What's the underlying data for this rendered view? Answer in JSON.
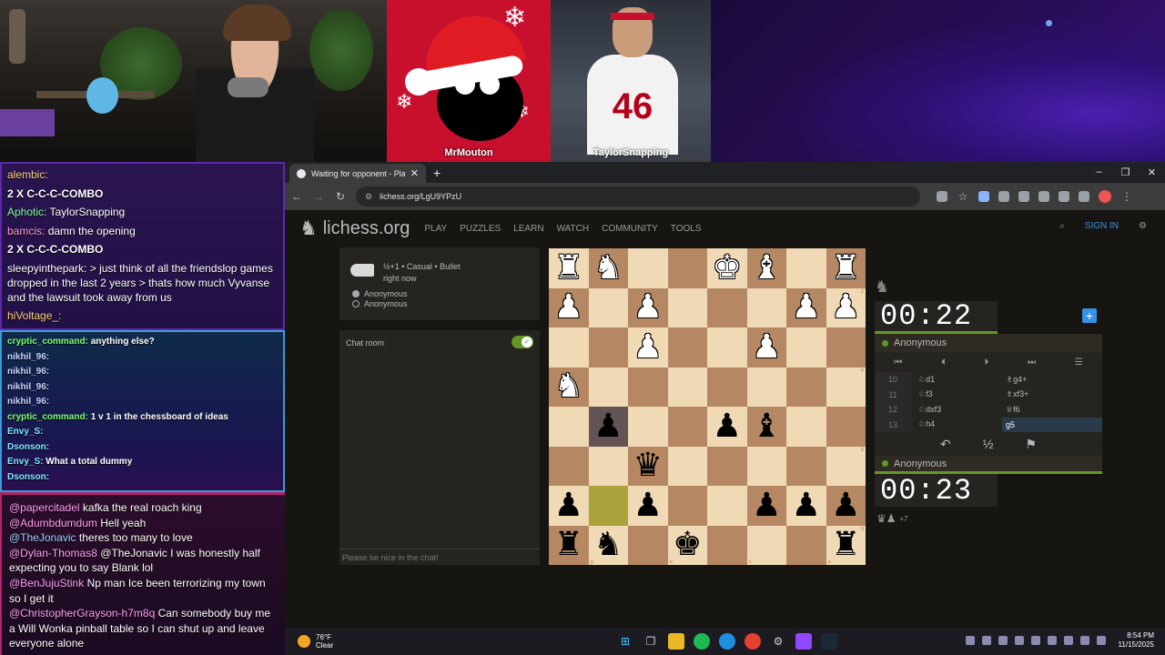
{
  "stream": {
    "cam_tiles": [
      {
        "name": "MrMouton"
      },
      {
        "name": "TaylorSnapping",
        "jersey_number": "46"
      }
    ]
  },
  "chat_panel_1": [
    {
      "user": "alembic:",
      "text": "",
      "style": "plain"
    },
    {
      "user": "",
      "text": "2 X C-C-C-COMBO",
      "style": "combo"
    },
    {
      "user": "Aphotic:",
      "text": "TaylorSnapping",
      "style": "green"
    },
    {
      "user": "bamcis:",
      "text": "damn the opening",
      "style": "pink"
    },
    {
      "user": "",
      "text": "2 X C-C-C-COMBO",
      "style": "combo"
    },
    {
      "user": "",
      "text": "sleepyinthepark: > just think of all the friendslop games dropped in the last 2 years > thats how much Vyvanse and the lawsuit took away from us",
      "style": "plain"
    },
    {
      "user": "hiVoltage_:",
      "text": "",
      "style": "plain"
    }
  ],
  "chat_panel_2": [
    {
      "user": "cryptic_command:",
      "text": "anything else?",
      "color": "green"
    },
    {
      "user": "nikhil_96:",
      "text": "",
      "color": ""
    },
    {
      "user": "nikhil_96:",
      "text": "",
      "color": ""
    },
    {
      "user": "nikhil_96:",
      "text": "",
      "color": ""
    },
    {
      "user": "nikhil_96:",
      "text": "",
      "color": ""
    },
    {
      "user": "cryptic_command:",
      "text": "1 v 1 in the chessboard of ideas",
      "color": "green"
    },
    {
      "user": "Envy_S:",
      "text": "",
      "color": "cyan"
    },
    {
      "user": "Dsonson:",
      "text": "",
      "color": "cyan"
    },
    {
      "user": "Envy_S:",
      "text": "What a total dummy",
      "color": "cyan"
    },
    {
      "user": "Dsonson:",
      "text": "",
      "color": "cyan"
    }
  ],
  "chat_panel_3": [
    {
      "user": "@papercitadel",
      "text": "kafka the real roach king",
      "color": ""
    },
    {
      "user": "@Adumbdumdum",
      "text": "Hell yeah",
      "color": ""
    },
    {
      "user": "@TheJonavic",
      "text": "theres too many to love",
      "color": "blue"
    },
    {
      "user": "@Dylan-Thomas8",
      "text": "@TheJonavic I was honestly half expecting you to say Blank lol",
      "color": ""
    },
    {
      "user": "@BenJujuStink",
      "text": "Np man Ice been terrorizing my town so I get it",
      "color": ""
    },
    {
      "user": "@ChristopherGrayson-h7m8q",
      "text": "Can somebody buy me a Will Wonka pinball table so I can shut up and leave everyone alone",
      "color": ""
    }
  ],
  "browser": {
    "tab_title": "Waiting for opponent - Play An",
    "url": "lichess.org/LgU9YPzU",
    "win_controls": [
      "–",
      "❐",
      "✕"
    ]
  },
  "lichess": {
    "logo_text": "lichess.org",
    "nav": [
      "PLAY",
      "PUZZLES",
      "LEARN",
      "WATCH",
      "COMMUNITY",
      "TOOLS"
    ],
    "sign_in": "SIGN IN",
    "game_mode": "½+1 • Casual • Bullet",
    "game_time": "right now",
    "players": [
      "Anonymous",
      "Anonymous"
    ],
    "chat_label": "Chat room",
    "chat_placeholder": "Please be nice in the chat!",
    "top_clock": "00:22",
    "bottom_clock": "00:23",
    "top_player": "Anonymous",
    "bottom_player": "Anonymous",
    "draw_symbol": "½",
    "material_diff": "+7",
    "moves": [
      {
        "n": "10",
        "w": "♘d1",
        "b": "♗g4+"
      },
      {
        "n": "11",
        "w": "♘f3",
        "b": "♗xf3+"
      },
      {
        "n": "12",
        "w": "♘dxf3",
        "b": "♕f6"
      },
      {
        "n": "13",
        "w": "♘h4",
        "b": "g5"
      }
    ]
  },
  "board": {
    "rows": [
      [
        "wr",
        "wn",
        "",
        "",
        "wk",
        "wb",
        "",
        "wr"
      ],
      [
        "wp",
        "",
        "wp",
        "",
        "",
        "",
        "wp",
        "wp"
      ],
      [
        "",
        "",
        "wp",
        "",
        "",
        "wp",
        "",
        ""
      ],
      [
        "wn",
        "",
        "",
        "",
        "",
        "",
        "",
        ""
      ],
      [
        "",
        "bp",
        "",
        "",
        "bp",
        "bb",
        "",
        ""
      ],
      [
        "",
        "",
        "bq",
        "",
        "",
        "",
        "",
        ""
      ],
      [
        "bp",
        "",
        "bp",
        "",
        "",
        "bp",
        "bp",
        "bp"
      ],
      [
        "br",
        "bn",
        "",
        "bk",
        "",
        "",
        "",
        "br"
      ]
    ],
    "highlight_last": [
      6,
      1
    ],
    "highlight_sel": [
      4,
      1
    ],
    "rank_labels": [
      "1",
      "2",
      "3",
      "4",
      "5",
      "6",
      "7",
      "8"
    ],
    "file_labels": [
      "h",
      "g",
      "f",
      "e",
      "d",
      "c",
      "b",
      "a"
    ]
  },
  "taskbar": {
    "temp": "76°F",
    "weather": "Clear",
    "time": "8:54 PM",
    "date": "11/15/2025"
  }
}
